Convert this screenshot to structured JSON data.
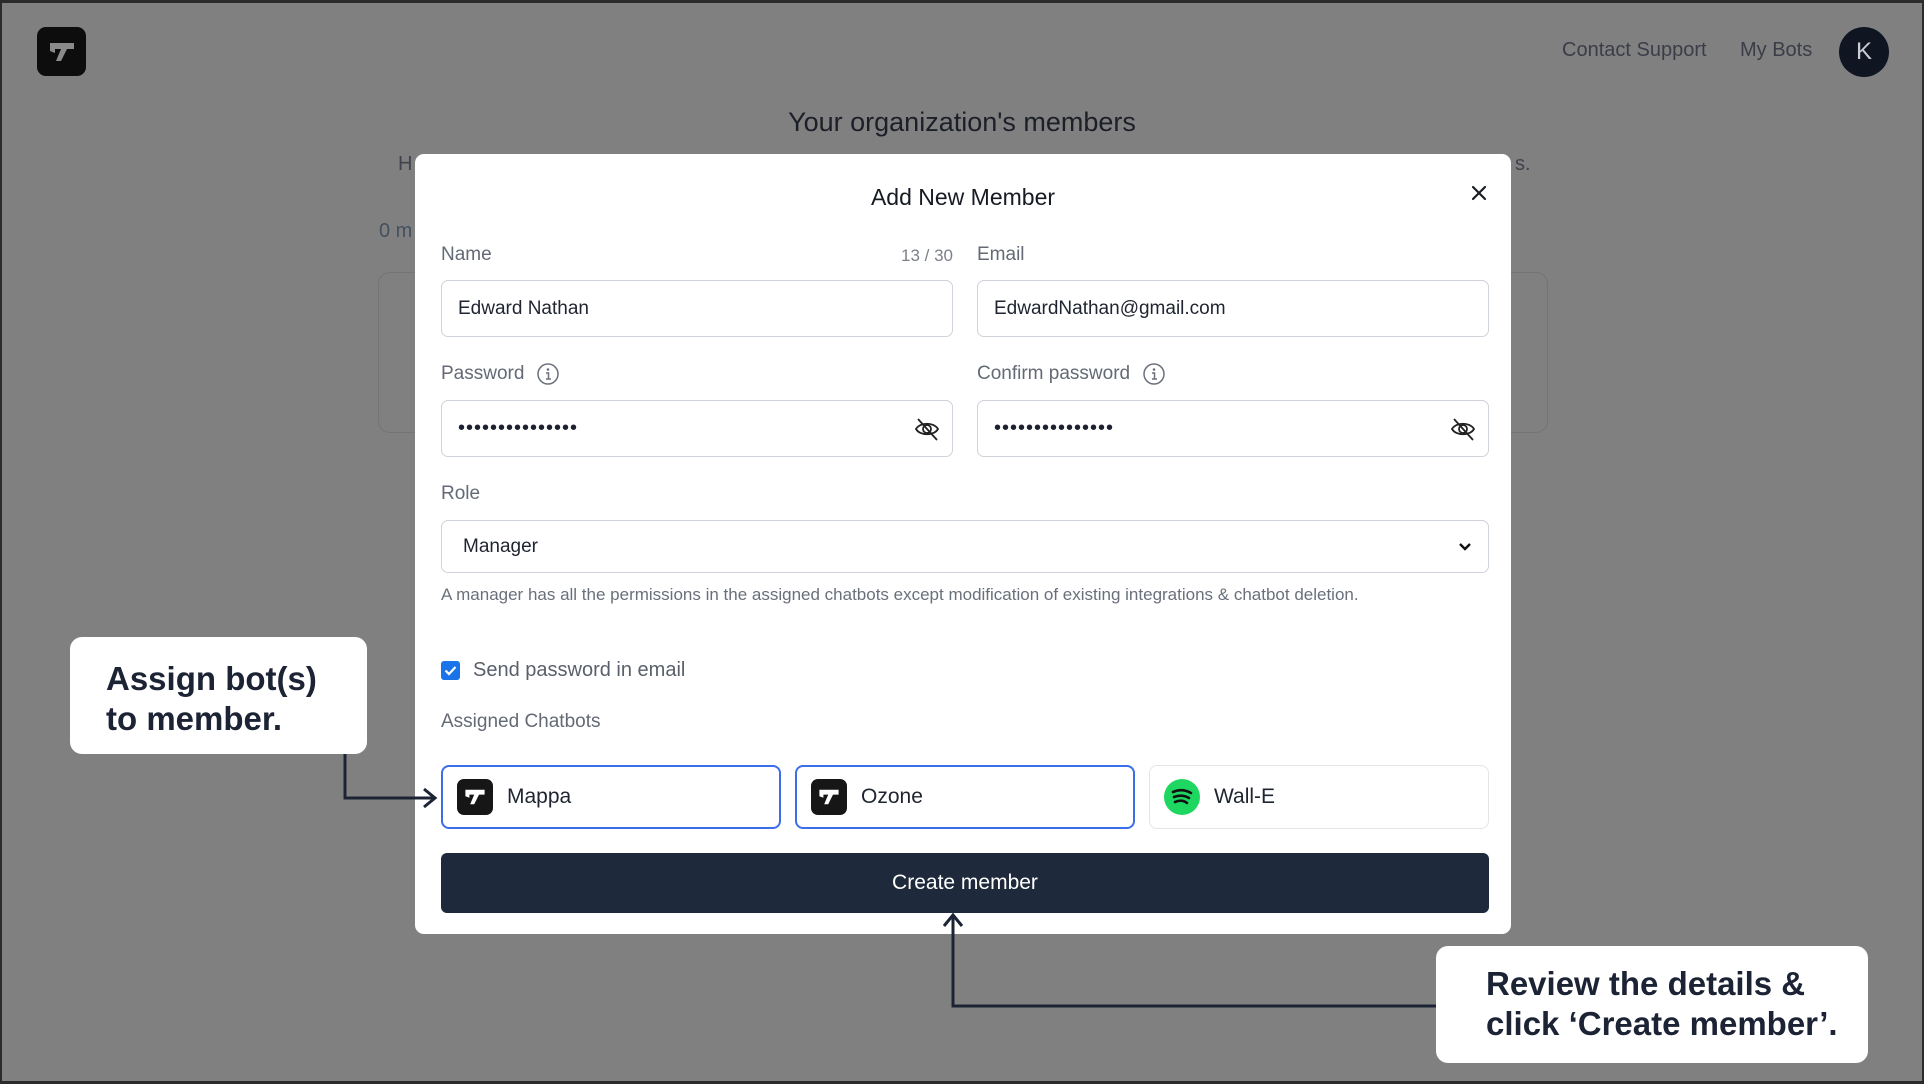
{
  "header": {
    "logo": "brand-logo",
    "nav": [
      "Contact Support",
      "My Bots"
    ],
    "avatar_initial": "K"
  },
  "page": {
    "title": "Your organization's members",
    "subtitle_left_fragment": "H",
    "subtitle_right_fragment": "s.",
    "count_fragment": "0 m"
  },
  "modal": {
    "title": "Add New Member",
    "close_icon": "close-icon",
    "name": {
      "label": "Name",
      "counter": "13 / 30",
      "value": "Edward Nathan"
    },
    "email": {
      "label": "Email",
      "value": "EdwardNathan@gmail.com"
    },
    "password": {
      "label": "Password",
      "value": "•••••••••••••••"
    },
    "confirm_password": {
      "label": "Confirm password",
      "value": "•••••••••••••••"
    },
    "role": {
      "label": "Role",
      "selected": "Manager",
      "help": "A manager has all the permissions in the assigned chatbots except modification of existing integrations & chatbot deletion."
    },
    "send_password": {
      "label": "Send password in email",
      "checked": true
    },
    "assigned_chatbots": {
      "label": "Assigned Chatbots",
      "items": [
        {
          "name": "Mappa",
          "icon": "brand-logo-icon",
          "selected": true
        },
        {
          "name": "Ozone",
          "icon": "brand-logo-icon",
          "selected": true
        },
        {
          "name": "Wall-E",
          "icon": "spotify-icon",
          "selected": false
        }
      ]
    },
    "create_button": "Create member"
  },
  "annotations": {
    "assign": {
      "line1": "Assign bot(s)",
      "line2": "to member."
    },
    "review": {
      "line1": "Review the details &",
      "line2": "click ‘Create member’."
    }
  },
  "colors": {
    "overlay_bg": "#808080",
    "primary_button": "#1e293b",
    "selected_border": "#3b6ee8",
    "checkbox": "#1a73e8",
    "spotify_green": "#1ed760",
    "annotation_ink": "#1b2334"
  }
}
